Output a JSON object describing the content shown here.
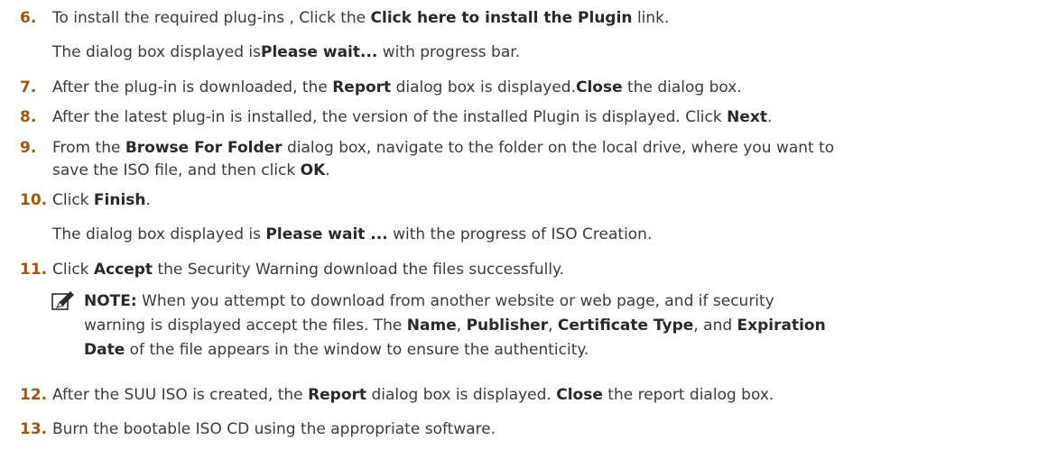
{
  "steps": [
    {
      "num": "6.",
      "lines": [
        [
          {
            "t": "To install the required plug-ins , Click the "
          },
          {
            "t": "Click here to install the Plugin",
            "b": true
          },
          {
            "t": " link."
          }
        ],
        [
          {
            "t": "The dialog box displayed is"
          },
          {
            "t": "Please wait...",
            "b": true
          },
          {
            "t": " with progress bar."
          }
        ]
      ]
    },
    {
      "num": "7.",
      "lines": [
        [
          {
            "t": "After the plug-in is downloaded, the "
          },
          {
            "t": "Report",
            "b": true
          },
          {
            "t": " dialog box is displayed."
          },
          {
            "t": "Close",
            "b": true
          },
          {
            "t": " the dialog box."
          }
        ]
      ]
    },
    {
      "num": "8.",
      "lines": [
        [
          {
            "t": "After the latest plug-in is installed, the version of the installed Plugin is displayed. Click "
          },
          {
            "t": "Next",
            "b": true
          },
          {
            "t": "."
          }
        ]
      ]
    },
    {
      "num": "9.",
      "lines": [
        [
          {
            "t": "From the "
          },
          {
            "t": "Browse For Folder",
            "b": true
          },
          {
            "t": " dialog box, navigate to the folder on the local drive, where you want to"
          }
        ],
        [
          {
            "t": "save the ISO file, and then click "
          },
          {
            "t": "OK",
            "b": true
          },
          {
            "t": "."
          }
        ]
      ]
    },
    {
      "num": "10.",
      "lines": [
        [
          {
            "t": "Click "
          },
          {
            "t": "Finish",
            "b": true
          },
          {
            "t": "."
          }
        ],
        [
          {
            "t": "The dialog box displayed is "
          },
          {
            "t": "Please wait ...",
            "b": true
          },
          {
            "t": " with the progress of ISO Creation."
          }
        ]
      ]
    },
    {
      "num": "11.",
      "lines": [
        [
          {
            "t": "Click "
          },
          {
            "t": "Accept",
            "b": true
          },
          {
            "t": " the Security Warning download the files successfully."
          }
        ]
      ]
    },
    {
      "num": "12.",
      "lines": [
        [
          {
            "t": "After the SUU ISO is created, the "
          },
          {
            "t": "Report",
            "b": true
          },
          {
            "t": " dialog box is displayed. "
          },
          {
            "t": "Close",
            "b": true
          },
          {
            "t": " the report dialog box."
          }
        ]
      ]
    },
    {
      "num": "13.",
      "lines": [
        [
          {
            "t": "Burn the bootable ISO CD using the appropriate software."
          }
        ]
      ]
    }
  ],
  "note": {
    "icon": "pencil-note-icon",
    "lines": [
      [
        {
          "t": "NOTE:",
          "b": true
        },
        {
          "t": " When you attempt to download from another website or web page, and if security"
        }
      ],
      [
        {
          "t": "warning is displayed accept the files. The "
        },
        {
          "t": "Name",
          "b": true
        },
        {
          "t": ", "
        },
        {
          "t": "Publisher",
          "b": true
        },
        {
          "t": ", "
        },
        {
          "t": "Certificate Type",
          "b": true
        },
        {
          "t": ", and "
        },
        {
          "t": "Expiration",
          "b": true
        }
      ],
      [
        {
          "t": "Date",
          "b": true
        },
        {
          "t": " of the file appears in the window to ensure the authenticity."
        }
      ]
    ]
  }
}
